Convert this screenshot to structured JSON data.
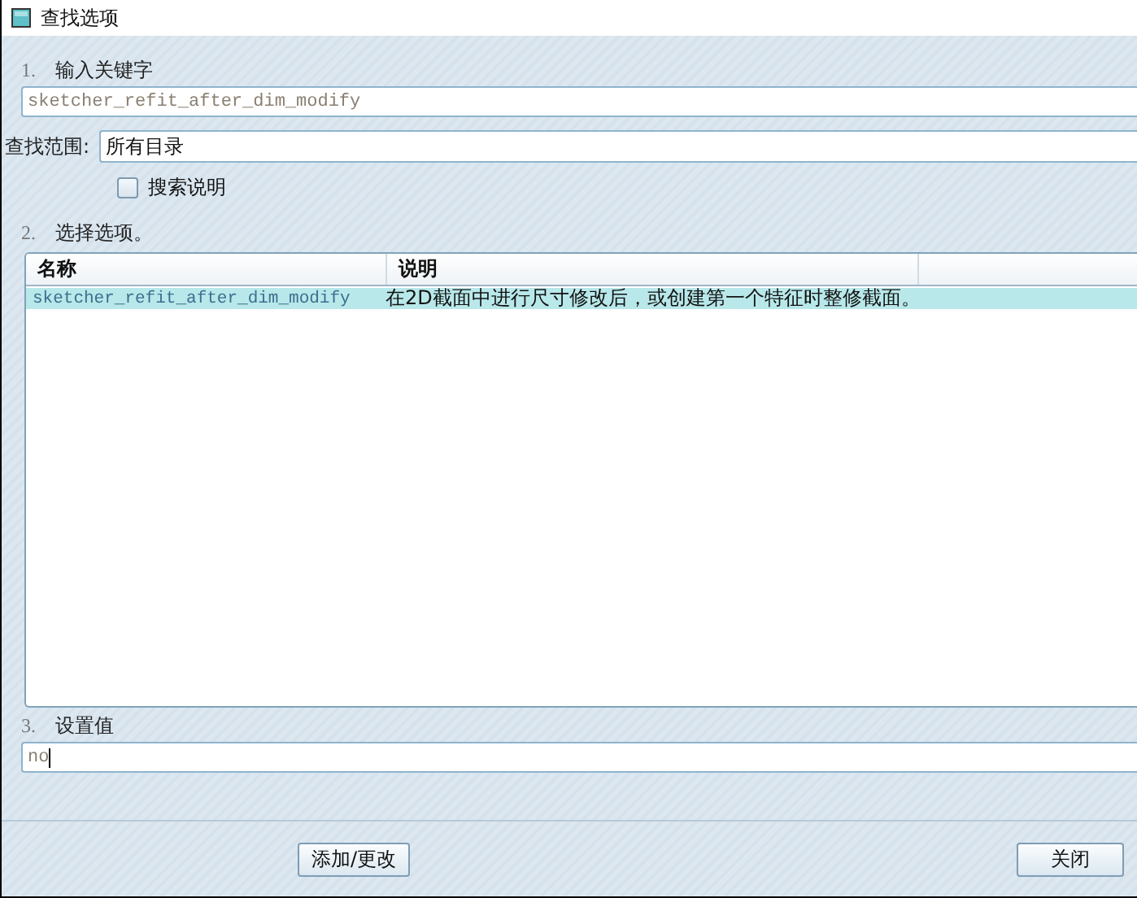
{
  "window": {
    "title": "查找选项"
  },
  "keyword": {
    "number": "1.",
    "label": "输入关键字",
    "value": "sketcher_refit_after_dim_modify"
  },
  "scope": {
    "label": "查找范围:",
    "value": "所有目录"
  },
  "search_description": {
    "label": "搜索说明",
    "checked": false
  },
  "options": {
    "number": "2.",
    "label": "选择选项。",
    "columns": [
      "名称",
      "说明"
    ],
    "rows": [
      {
        "name": "sketcher_refit_after_dim_modify",
        "description": "在2D截面中进行尺寸修改后，或创建第一个特征时整修截面。",
        "selected": true
      }
    ]
  },
  "value": {
    "number": "3.",
    "label": "设置值",
    "value": "no"
  },
  "buttons": [
    "添加/更改",
    "关闭"
  ]
}
